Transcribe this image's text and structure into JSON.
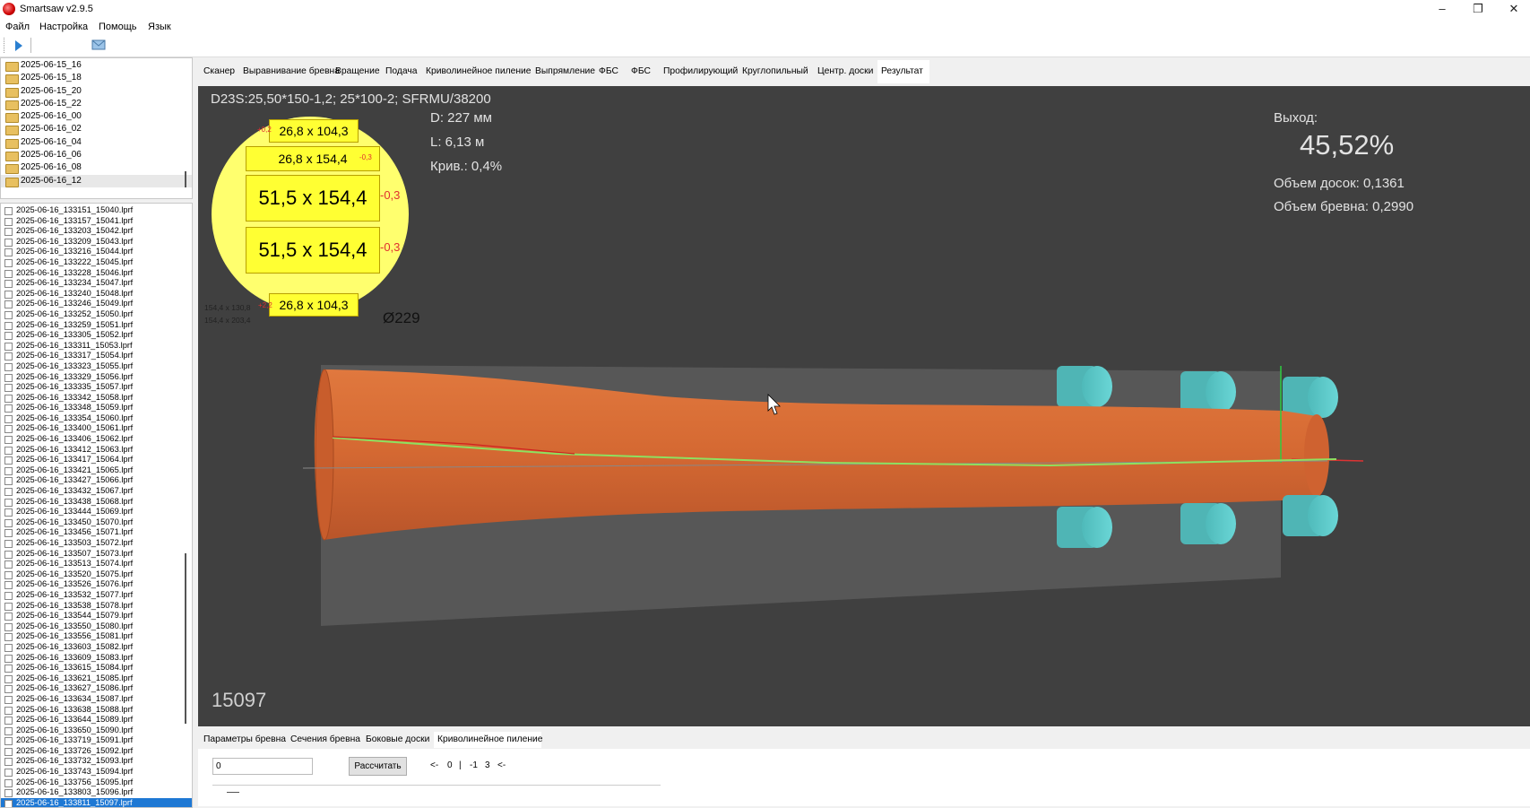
{
  "window": {
    "title": "Smartsaw v2.9.5",
    "minimize": "–",
    "maximize": "❐",
    "close": "✕"
  },
  "menu": [
    "Файл",
    "Настройка",
    "Помощь",
    "Язык"
  ],
  "toolbar": {
    "play_icon": "play-icon",
    "mail_icon": "envelope-icon"
  },
  "folders": [
    "2025-06-15_16",
    "2025-06-15_18",
    "2025-06-15_20",
    "2025-06-15_22",
    "2025-06-16_00",
    "2025-06-16_02",
    "2025-06-16_04",
    "2025-06-16_06",
    "2025-06-16_08",
    "2025-06-16_12"
  ],
  "selected_folder": "2025-06-16_12",
  "files": [
    "2025-06-16_133151_15040.lprf",
    "2025-06-16_133157_15041.lprf",
    "2025-06-16_133203_15042.lprf",
    "2025-06-16_133209_15043.lprf",
    "2025-06-16_133216_15044.lprf",
    "2025-06-16_133222_15045.lprf",
    "2025-06-16_133228_15046.lprf",
    "2025-06-16_133234_15047.lprf",
    "2025-06-16_133240_15048.lprf",
    "2025-06-16_133246_15049.lprf",
    "2025-06-16_133252_15050.lprf",
    "2025-06-16_133259_15051.lprf",
    "2025-06-16_133305_15052.lprf",
    "2025-06-16_133311_15053.lprf",
    "2025-06-16_133317_15054.lprf",
    "2025-06-16_133323_15055.lprf",
    "2025-06-16_133329_15056.lprf",
    "2025-06-16_133335_15057.lprf",
    "2025-06-16_133342_15058.lprf",
    "2025-06-16_133348_15059.lprf",
    "2025-06-16_133354_15060.lprf",
    "2025-06-16_133400_15061.lprf",
    "2025-06-16_133406_15062.lprf",
    "2025-06-16_133412_15063.lprf",
    "2025-06-16_133417_15064.lprf",
    "2025-06-16_133421_15065.lprf",
    "2025-06-16_133427_15066.lprf",
    "2025-06-16_133432_15067.lprf",
    "2025-06-16_133438_15068.lprf",
    "2025-06-16_133444_15069.lprf",
    "2025-06-16_133450_15070.lprf",
    "2025-06-16_133456_15071.lprf",
    "2025-06-16_133503_15072.lprf",
    "2025-06-16_133507_15073.lprf",
    "2025-06-16_133513_15074.lprf",
    "2025-06-16_133520_15075.lprf",
    "2025-06-16_133526_15076.lprf",
    "2025-06-16_133532_15077.lprf",
    "2025-06-16_133538_15078.lprf",
    "2025-06-16_133544_15079.lprf",
    "2025-06-16_133550_15080.lprf",
    "2025-06-16_133556_15081.lprf",
    "2025-06-16_133603_15082.lprf",
    "2025-06-16_133609_15083.lprf",
    "2025-06-16_133615_15084.lprf",
    "2025-06-16_133621_15085.lprf",
    "2025-06-16_133627_15086.lprf",
    "2025-06-16_133634_15087.lprf",
    "2025-06-16_133638_15088.lprf",
    "2025-06-16_133644_15089.lprf",
    "2025-06-16_133650_15090.lprf",
    "2025-06-16_133719_15091.lprf",
    "2025-06-16_133726_15092.lprf",
    "2025-06-16_133732_15093.lprf",
    "2025-06-16_133743_15094.lprf",
    "2025-06-16_133756_15095.lprf",
    "2025-06-16_133803_15096.lprf",
    "2025-06-16_133811_15097.lprf"
  ],
  "selected_file": "2025-06-16_133811_15097.lprf",
  "tabs": [
    "Сканер",
    "Выравнивание бревна",
    "Вращение",
    "Подача",
    "Криволинейное пиление",
    "Выпрямление",
    "ФБС",
    "ФБС",
    "Профилирующий",
    "Круглопильный",
    "Центр. доски",
    "Результат"
  ],
  "active_tab": "Результат",
  "viewport": {
    "scheme": "D23S:25,50*150-1,2; 25*100-2; SFRMU/38200",
    "diameter": "D: 227 мм",
    "length": "L: 6,13 м",
    "curvature": "Крив.: 0,4%",
    "yield_label": "Выход:",
    "yield_value": "45,52%",
    "boards_volume": "Объем досок: 0,1361",
    "log_volume": "Объем бревна: 0,2990",
    "log_number": "15097",
    "circle_diameter": "Ø229",
    "small_line_1": "154,4 x 130,8",
    "small_line_2": "154,4 x 203,4",
    "boards": [
      {
        "label": "26,8 x 104,3",
        "delta": "+0,2"
      },
      {
        "label": "26,8 x 154,4",
        "delta": "-0,3"
      },
      {
        "label": "51,5 x 154,4",
        "delta": "-0,3"
      },
      {
        "label": "51,5 x 154,4",
        "delta": "-0,3"
      },
      {
        "label": "26,8 x 104,3",
        "delta": "+2,2"
      }
    ],
    "colors": {
      "log": "#d86a34",
      "roller": "#5ccaca",
      "background": "#404040",
      "board": "#ffff33",
      "circle": "#ffff6e"
    }
  },
  "bottom_tabs": [
    "Параметры бревна",
    "Сечения бревна",
    "Боковые доски",
    "Криволинейное пиление"
  ],
  "active_bottom_tab": "Криволинейное пиление",
  "bottom": {
    "input_value": "0",
    "calc_button": "Рассчитать",
    "nav": [
      "<-",
      "0",
      "|",
      "-1",
      "3",
      "<-"
    ]
  }
}
